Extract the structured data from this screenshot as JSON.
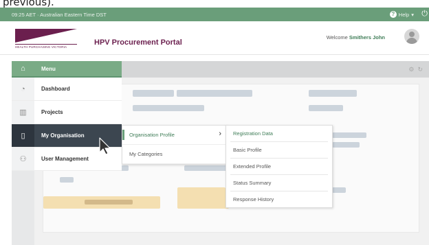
{
  "caption": "previous).",
  "topbar": {
    "time": "09:25 AET · Australian Eastern Time DST",
    "help_label": "Help",
    "help_icon": "question-circle-icon",
    "power_icon": "power-icon"
  },
  "header": {
    "logo_text": "HEALTH PURCHASING VICTORIA",
    "portal_title": "HPV Procurement Portal",
    "welcome_prefix": "Welcome",
    "user_name": "Smithers John"
  },
  "menu": {
    "label": "Menu",
    "items": [
      {
        "label": "Dashboard",
        "icon": "dashboard-icon"
      },
      {
        "label": "Projects",
        "icon": "projects-icon"
      },
      {
        "label": "My Organisation",
        "icon": "building-icon",
        "active": true
      },
      {
        "label": "User Management",
        "icon": "users-icon"
      }
    ]
  },
  "submenu": {
    "items": [
      {
        "label": "Organisation Profile",
        "selected": true
      },
      {
        "label": "My Categories"
      }
    ]
  },
  "submenu2": {
    "items": [
      {
        "label": "Registration Data",
        "selected": true
      },
      {
        "label": "Basic Profile"
      },
      {
        "label": "Extended Profile"
      },
      {
        "label": "Status Summary"
      },
      {
        "label": "Response History"
      }
    ]
  },
  "colors": {
    "accent": "#6a9e7a",
    "brand": "#6b1f4e",
    "menu_active": "#3c4650"
  }
}
